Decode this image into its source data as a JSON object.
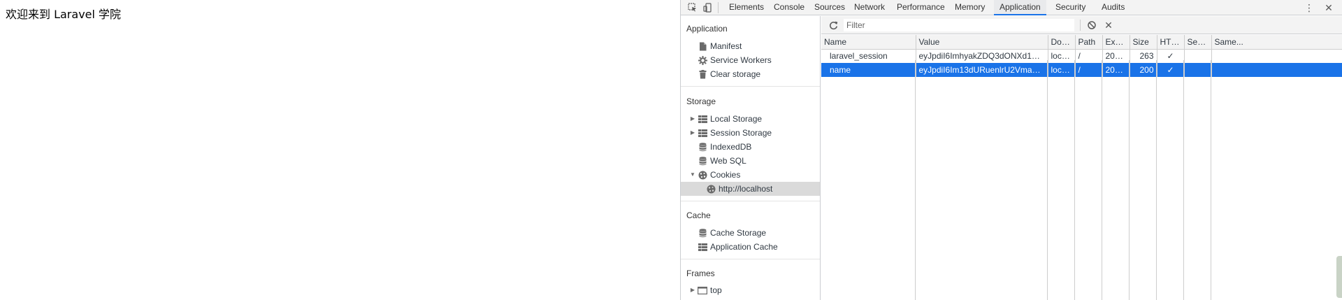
{
  "page": {
    "welcome_text": "欢迎来到 Laravel 学院"
  },
  "devtools": {
    "tabs": [
      "Elements",
      "Console",
      "Sources",
      "Network",
      "Performance",
      "Memory",
      "Application",
      "Security",
      "Audits"
    ],
    "active_tab": "Application",
    "icons": {
      "inspect": "inspect-element-icon",
      "device": "device-toolbar-icon",
      "more": "kebab-menu-icon",
      "close": "close-icon"
    },
    "accent_color": "#1a73e8"
  },
  "sidebar": {
    "application": {
      "title": "Application",
      "items": [
        {
          "label": "Manifest",
          "icon": "document-icon"
        },
        {
          "label": "Service Workers",
          "icon": "gear-icon"
        },
        {
          "label": "Clear storage",
          "icon": "trash-icon"
        }
      ]
    },
    "storage": {
      "title": "Storage",
      "items": [
        {
          "label": "Local Storage",
          "icon": "table-icon",
          "expandable": "collapsed"
        },
        {
          "label": "Session Storage",
          "icon": "table-icon",
          "expandable": "collapsed"
        },
        {
          "label": "IndexedDB",
          "icon": "database-icon"
        },
        {
          "label": "Web SQL",
          "icon": "database-icon"
        },
        {
          "label": "Cookies",
          "icon": "cookie-icon",
          "expandable": "expanded"
        },
        {
          "label": "http://localhost",
          "icon": "cookie-icon",
          "selected": true
        }
      ]
    },
    "cache": {
      "title": "Cache",
      "items": [
        {
          "label": "Cache Storage",
          "icon": "database-icon"
        },
        {
          "label": "Application Cache",
          "icon": "table-icon"
        }
      ]
    },
    "frames": {
      "title": "Frames",
      "items": [
        {
          "label": "top",
          "icon": "frame-icon",
          "expandable": "collapsed"
        }
      ]
    }
  },
  "cookies": {
    "filter_placeholder": "Filter",
    "columns": [
      "Name",
      "Value",
      "Dom...",
      "Path",
      "Expir...",
      "Size",
      "HTTP",
      "Secure",
      "Same..."
    ],
    "rows": [
      {
        "name": "laravel_session",
        "value": "eyJpdiI6ImhyakZDQ3dONXd1aEJZRDFiO...",
        "domain": "local...",
        "path": "/",
        "expires": "2019...",
        "size": "263",
        "http": "✓",
        "secure": "",
        "samesite": "",
        "selected": false
      },
      {
        "name": "name",
        "value": "eyJpdiI6Im13dURuenlrU2VmanE3S2FYT...",
        "domain": "local...",
        "path": "/",
        "expires": "2019...",
        "size": "200",
        "http": "✓",
        "secure": "",
        "samesite": "",
        "selected": true
      }
    ]
  }
}
